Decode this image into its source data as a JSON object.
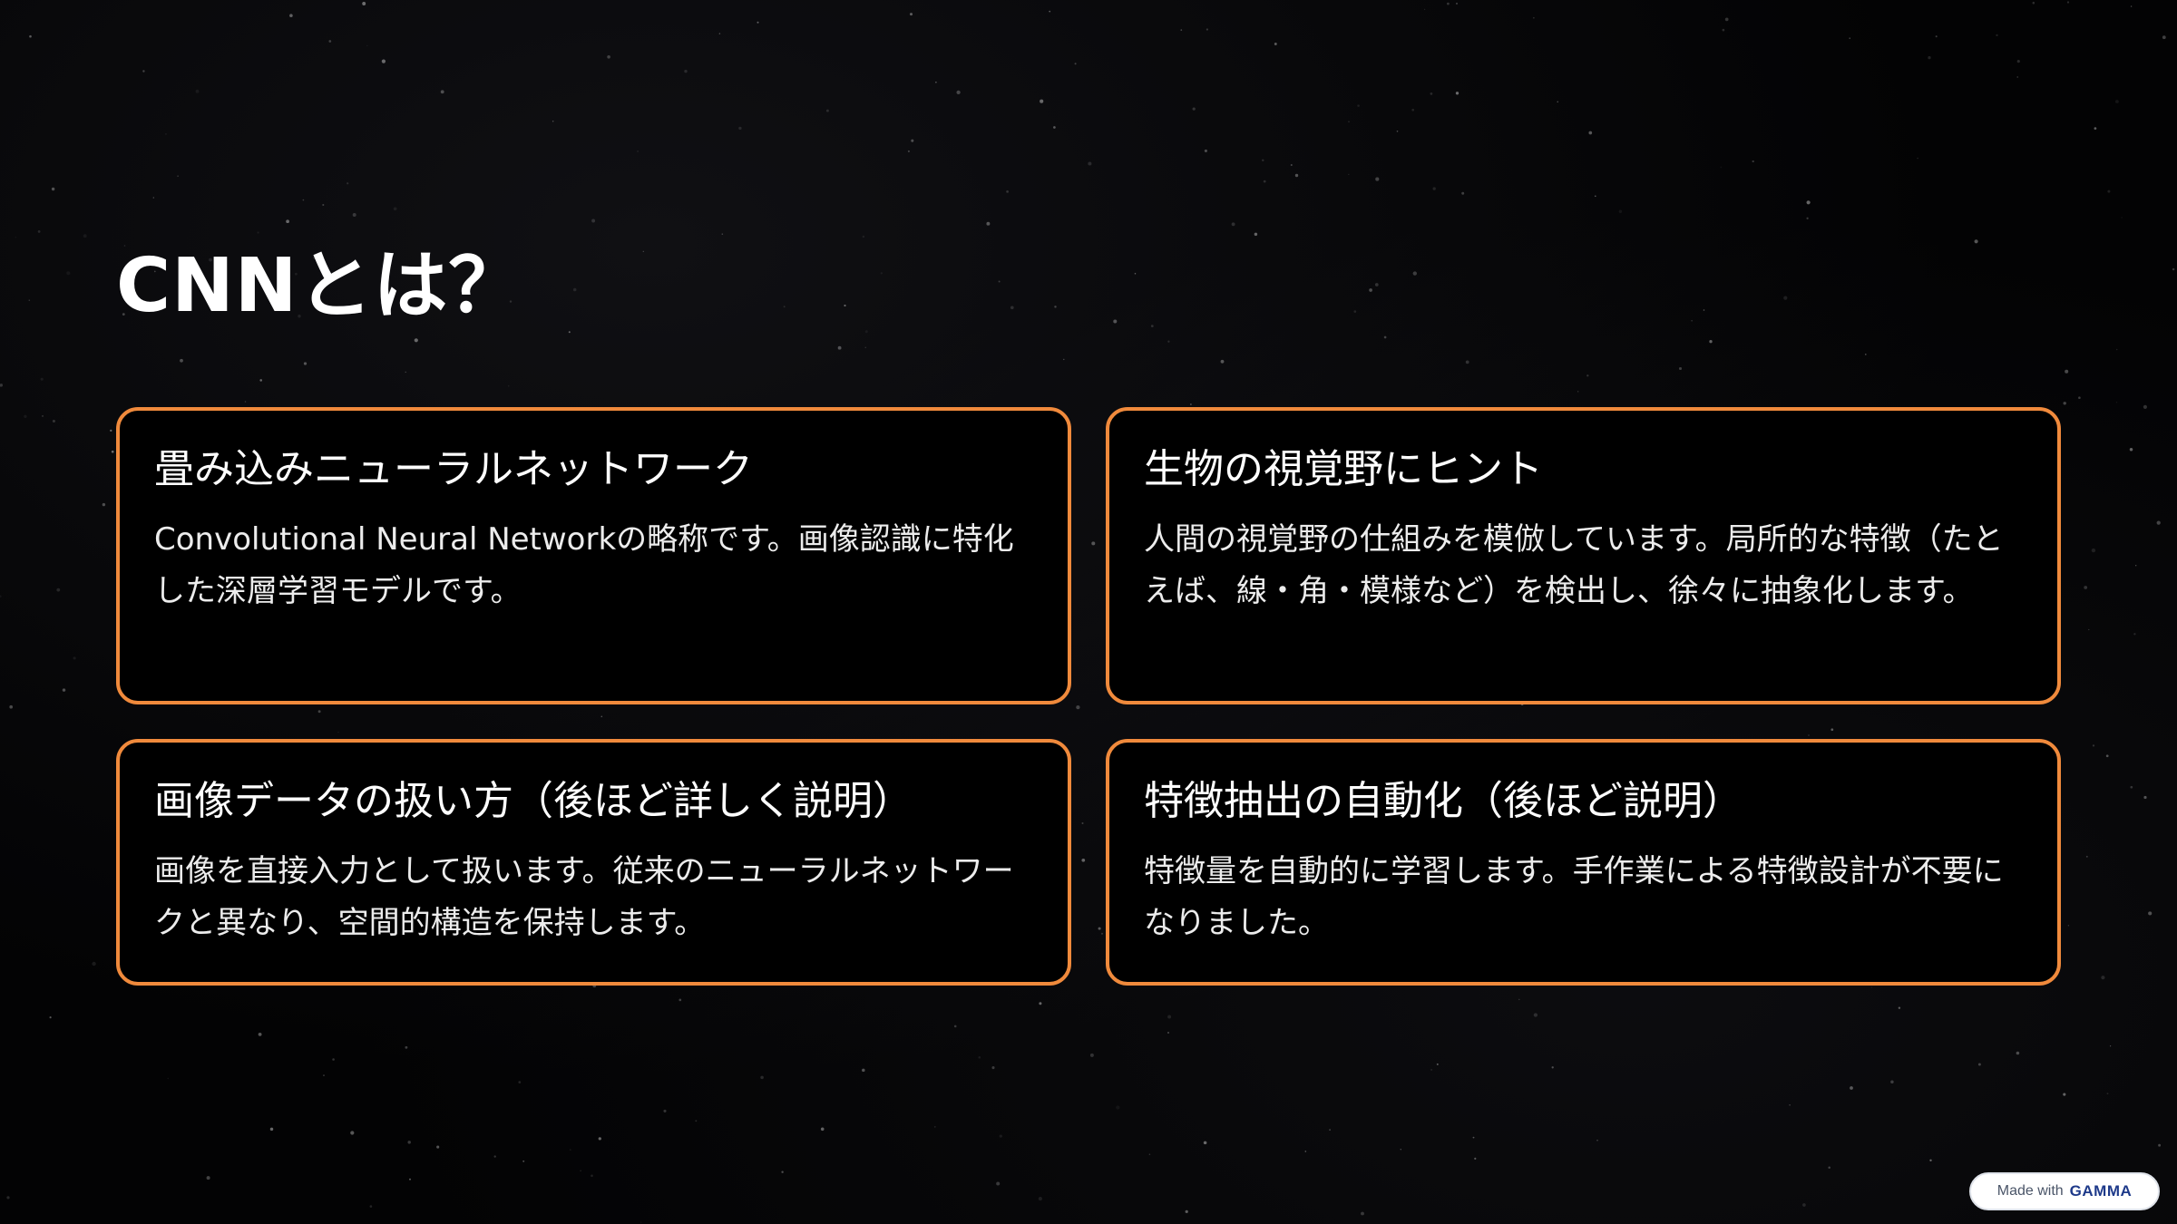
{
  "slide": {
    "title": "CNNとは？"
  },
  "cards": [
    {
      "heading": "畳み込みニューラルネットワーク",
      "body": "Convolutional Neural Networkの略称です。画像認識に特化した深層学習モデルです。"
    },
    {
      "heading": "生物の視覚野にヒント",
      "body": "人間の視覚野の仕組みを模倣しています。局所的な特徴（たとえば、線・角・模様など）を検出し、徐々に抽象化します。"
    },
    {
      "heading": "画像データの扱い方（後ほど詳しく説明）",
      "body": "画像を直接入力として扱います。従来のニューラルネットワークと異なり、空間的構造を保持します。"
    },
    {
      "heading": "特徴抽出の自動化（後ほど説明）",
      "body": "特徴量を自動的に学習します。手作業による特徴設計が不要になりました。"
    }
  ],
  "badge": {
    "prefix": "Made with",
    "brand": "GAMMA"
  },
  "colors": {
    "background": "#030304",
    "card_border": "#f08a3c",
    "text": "#ffffff"
  }
}
